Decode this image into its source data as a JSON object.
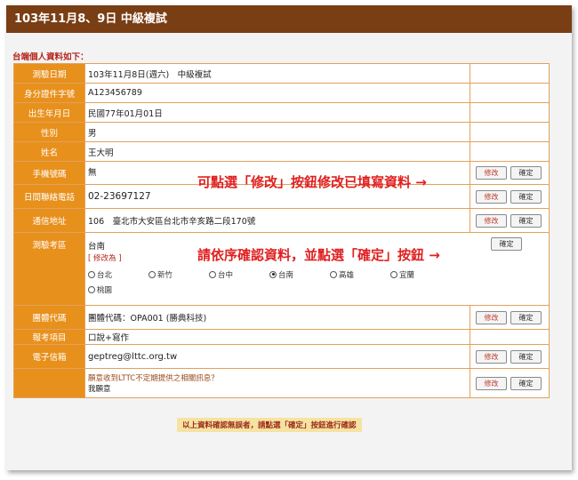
{
  "header": {
    "title": "103年11月8、9日 中級複試"
  },
  "intro": "台端個人資料如下：",
  "buttons": {
    "edit": "修改",
    "confirm": "確定"
  },
  "rows": {
    "exam_date": {
      "label": "測驗日期",
      "value": "103年11月8日(週六)　中級複試"
    },
    "id": {
      "label": "身分證件字號",
      "value": "A123456789"
    },
    "birth": {
      "label": "出生年月日",
      "value": "民國77年01月01日"
    },
    "gender": {
      "label": "性別",
      "value": "男"
    },
    "name": {
      "label": "姓名",
      "value": "王大明"
    },
    "mobile": {
      "label": "手機號碼",
      "value": "無"
    },
    "day_phone": {
      "label": "日間聯絡電話",
      "value": "02-23697127"
    },
    "address": {
      "label": "通信地址",
      "value": "106　臺北市大安區台北市辛亥路二段170號"
    },
    "region": {
      "label": "測驗考區",
      "value": "台南",
      "change_label": "[ 修改為 ]",
      "options": [
        "台北",
        "新竹",
        "台中",
        "台南",
        "高雄",
        "宜蘭",
        "桃園"
      ],
      "selected": "台南"
    },
    "group_code": {
      "label": "團體代碼",
      "value": "團體代碼：OPA001 (勝典科技)"
    },
    "exam_item": {
      "label": "報考項目",
      "value": "口說+寫作"
    },
    "email": {
      "label": "電子信箱",
      "value": "geptreg@lttc.org.tw"
    },
    "newsletter": {
      "question": "願意收到LTTC不定期提供之相關訊息？",
      "answer": "我願意"
    }
  },
  "callouts": {
    "edit_hint": "可點選「修改」按鈕修改已填寫資料 →",
    "confirm_hint": "請依序確認資料，並點選「確定」按鈕 →"
  },
  "footer_note": "以上資料確認無誤者，請點選「確定」按鈕進行確認"
}
